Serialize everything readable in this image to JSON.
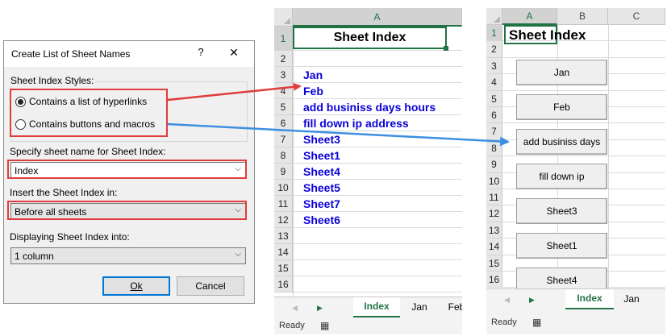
{
  "dialog": {
    "title": "Create List of Sheet Names",
    "help": "?",
    "close": "✕",
    "styles_legend": "Sheet Index Styles:",
    "radio_hyperlinks": "Contains a list of hyperlinks",
    "radio_buttons": "Contains buttons and macros",
    "selected_style": "hyperlinks",
    "name_label": "Specify sheet name for Sheet Index:",
    "name_value": "Index",
    "insert_label": "Insert the Sheet Index in:",
    "insert_value": "Before all sheets",
    "display_label": "Displaying Sheet Index into:",
    "display_value": "1 column",
    "ok_label": "Ok",
    "cancel_label": "Cancel"
  },
  "sheet1": {
    "column": "A",
    "rows": [
      "1",
      "2",
      "3",
      "4",
      "5",
      "6",
      "7",
      "8",
      "9",
      "10",
      "11",
      "12",
      "13",
      "14",
      "15",
      "16"
    ],
    "title": "Sheet Index",
    "items": [
      "Jan",
      "Feb",
      "add businiss days hours",
      "fill down ip address",
      "Sheet3",
      "Sheet1",
      "Sheet4",
      "Sheet5",
      "Sheet7",
      "Sheet6"
    ],
    "tabs": [
      "Index",
      "Jan",
      "Feb"
    ],
    "status": "Ready"
  },
  "sheet2": {
    "columns": [
      "A",
      "B",
      "C"
    ],
    "rows": [
      "1",
      "2",
      "3",
      "4",
      "5",
      "6",
      "7",
      "8",
      "9",
      "10",
      "11",
      "12",
      "13",
      "14",
      "15",
      "16"
    ],
    "title": "Sheet Index",
    "buttons": [
      "Jan",
      "Feb",
      "add businiss days",
      "fill down ip",
      "Sheet3",
      "Sheet1",
      "Sheet4"
    ],
    "tabs": [
      "Index",
      "Jan"
    ],
    "status": "Ready"
  },
  "colors": {
    "annotation_red": "#e03c3c",
    "annotation_blue": "#3d8fe0",
    "link_blue": "#0b00d7",
    "excel_green": "#217346"
  },
  "icons": {
    "nav_left": "◀",
    "nav_right": "▶",
    "chevron": "⌵",
    "status_icon": "▦"
  }
}
